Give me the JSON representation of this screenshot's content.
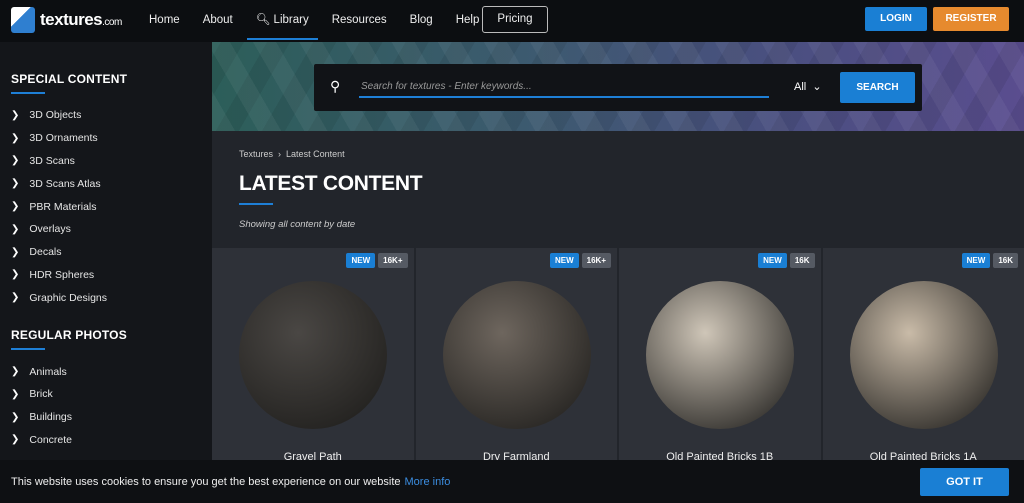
{
  "header": {
    "logo": "textures",
    "logo_suffix": ".com",
    "nav": [
      "Home",
      "About",
      "Library",
      "Resources",
      "Blog",
      "Help"
    ],
    "pricing": "Pricing",
    "login": "LOGIN",
    "register": "REGISTER"
  },
  "sidebar": {
    "sections": [
      {
        "title": "SPECIAL CONTENT",
        "items": [
          "3D Objects",
          "3D Ornaments",
          "3D Scans",
          "3D Scans Atlas",
          "PBR Materials",
          "Overlays",
          "Decals",
          "HDR Spheres",
          "Graphic Designs"
        ]
      },
      {
        "title": "REGULAR PHOTOS",
        "items": [
          "Animals",
          "Brick",
          "Buildings",
          "Concrete"
        ]
      }
    ]
  },
  "search": {
    "placeholder": "Search for textures - Enter keywords...",
    "filter": "All",
    "button": "SEARCH"
  },
  "breadcrumb": [
    "Textures",
    "Latest Content"
  ],
  "page": {
    "title": "LATEST CONTENT",
    "subtitle": "Showing all content by date"
  },
  "cards": [
    {
      "name": "Gravel Path",
      "badges": [
        "NEW",
        "16K+"
      ],
      "color": "#4a4744"
    },
    {
      "name": "Dry Farmland",
      "badges": [
        "NEW",
        "16K+"
      ],
      "color": "#6e665e"
    },
    {
      "name": "Old Painted Bricks 1B",
      "badges": [
        "NEW",
        "16K"
      ],
      "color": "#cfc6b8"
    },
    {
      "name": "Old Painted Bricks 1A",
      "badges": [
        "NEW",
        "16K"
      ],
      "color": "#c9bba8"
    }
  ],
  "cookie": {
    "text": "This website uses cookies to ensure you get the best experience on our website",
    "link": "More info",
    "button": "GOT IT"
  }
}
